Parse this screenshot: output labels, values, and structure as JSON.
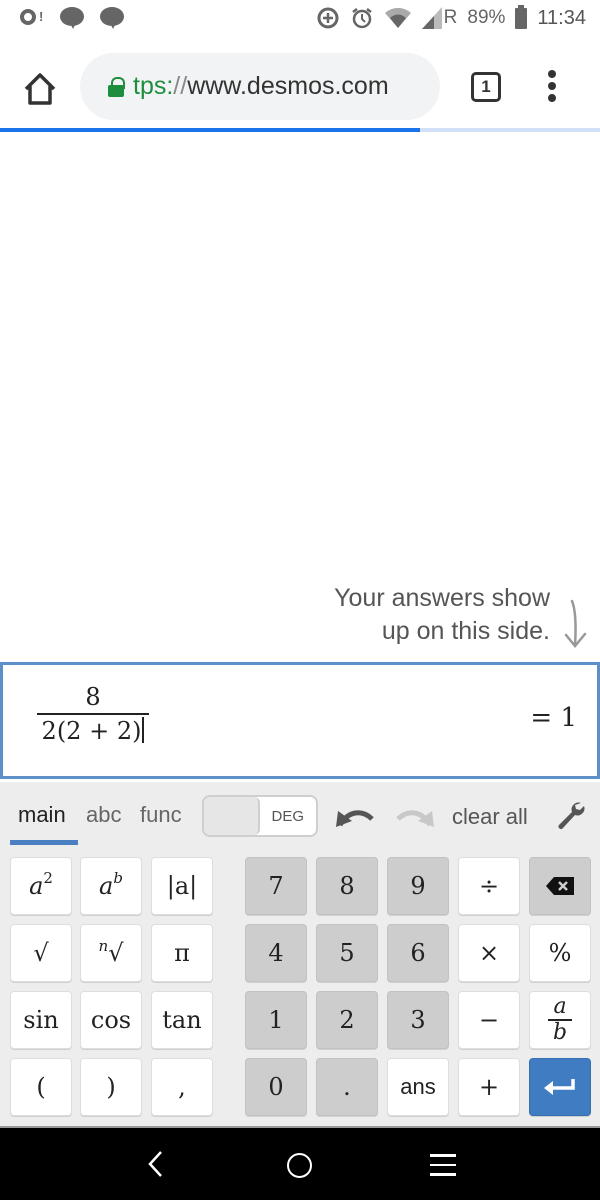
{
  "status_bar": {
    "left_icons": [
      "tiktok-notification-icon",
      "message-bubble-icon",
      "message-bubble-icon"
    ],
    "right_icons": [
      "data-saver-icon",
      "alarm-icon",
      "wifi-icon",
      "signal-icon"
    ],
    "roaming": "R",
    "battery": "89%",
    "time": "11:34"
  },
  "browser": {
    "url_scheme": "tps:",
    "url_sep": "//",
    "url_host": "www.desmos.com",
    "tab_count": "1",
    "load_progress": 0.7,
    "colors": {
      "secure": "#1e8e3e",
      "progress": "#1a73e8"
    }
  },
  "graph": {
    "hint_line1": "Your answers show",
    "hint_line2": "up on this side."
  },
  "expression": {
    "numerator": "8",
    "denominator": "2(2 + 2)",
    "result": "= 1",
    "accent": "#5d8fc9"
  },
  "keypad": {
    "tabs": [
      {
        "label": "main",
        "active": true
      },
      {
        "label": "abc",
        "active": false
      },
      {
        "label": "func",
        "active": false
      }
    ],
    "angle_mode": "DEG",
    "clear_all": "clear all",
    "keys": {
      "a_squared": {
        "base": "a",
        "exp": "2"
      },
      "a_power_b": {
        "base": "a",
        "exp": "b"
      },
      "abs": "|a|",
      "sqrt": "√",
      "nth_root_index": "n",
      "nth_root": "√",
      "pi": "π",
      "sin": "sin",
      "cos": "cos",
      "tan": "tan",
      "lparen": "(",
      "rparen": ")",
      "comma": ",",
      "d7": "7",
      "d8": "8",
      "d9": "9",
      "d4": "4",
      "d5": "5",
      "d6": "6",
      "d1": "1",
      "d2": "2",
      "d3": "3",
      "d0": "0",
      "dot": ".",
      "ans": "ans",
      "divide": "÷",
      "times": "×",
      "minus": "−",
      "plus": "+",
      "percent": "%",
      "frac_num": "a",
      "frac_den": "b"
    },
    "enter_color": "#3f7cc1"
  }
}
